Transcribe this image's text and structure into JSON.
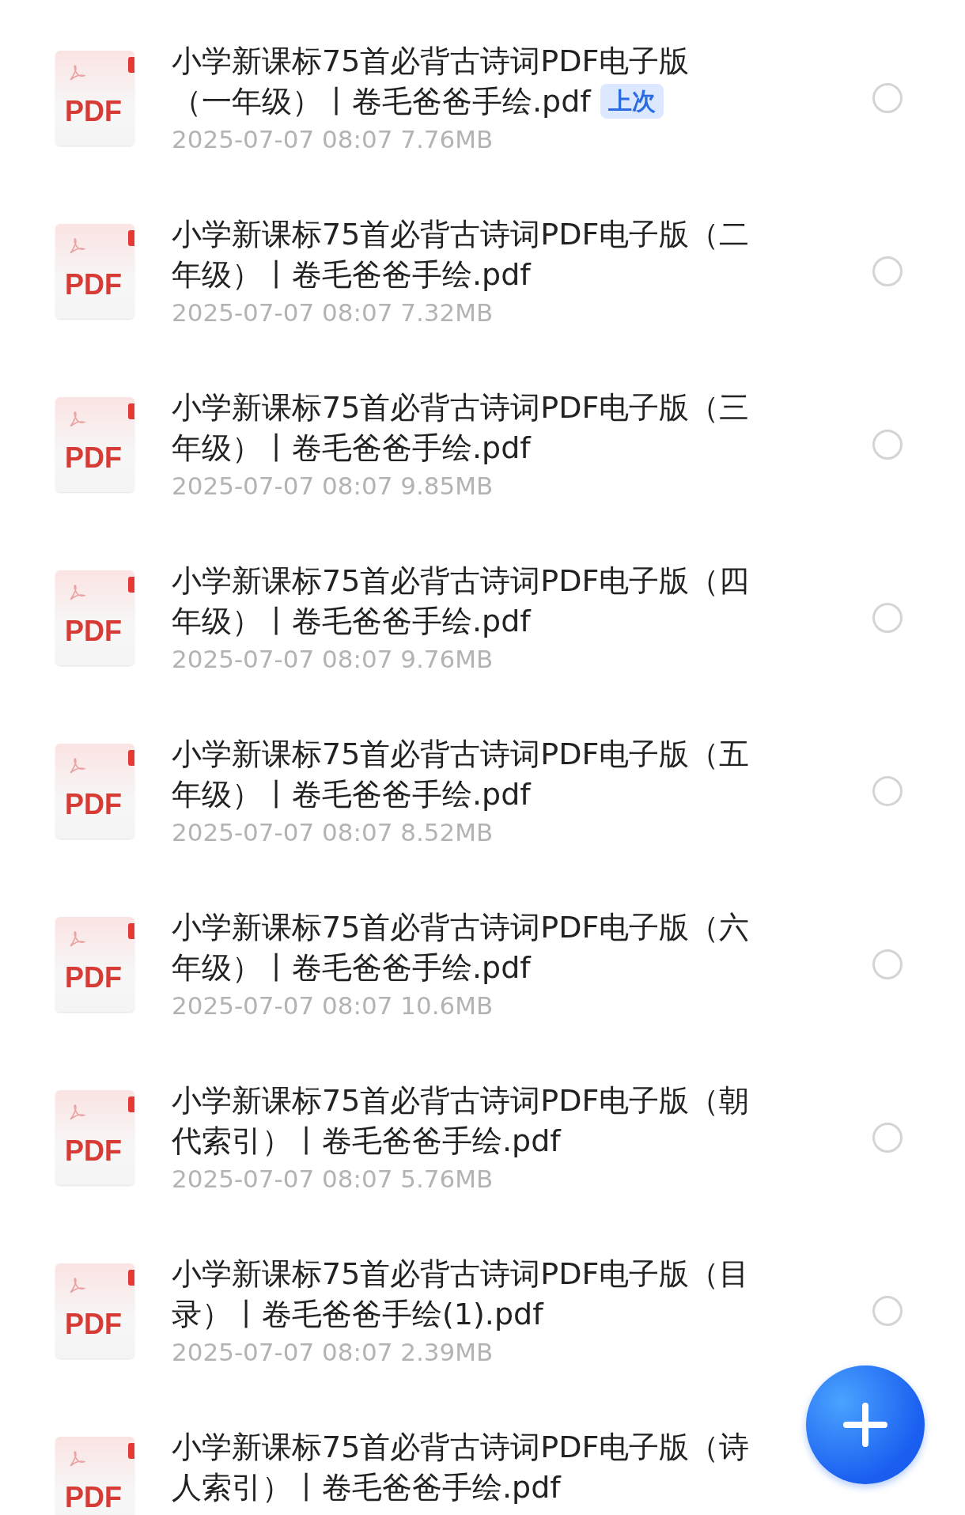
{
  "files": [
    {
      "icon_label": "PDF",
      "title": [
        "小学新课标75首必背古诗词PDF电子版",
        "（一年级）丨卷毛爸爸手绘.pdf"
      ],
      "badge": "上次",
      "meta": "2025-07-07 08:07  7.76MB",
      "selected": false
    },
    {
      "icon_label": "PDF",
      "title": [
        "小学新课标75首必背古诗词PDF电子版（二",
        "年级）丨卷毛爸爸手绘.pdf"
      ],
      "meta": "2025-07-07 08:07  7.32MB",
      "selected": false
    },
    {
      "icon_label": "PDF",
      "title": [
        "小学新课标75首必背古诗词PDF电子版（三",
        "年级）丨卷毛爸爸手绘.pdf"
      ],
      "meta": "2025-07-07 08:07  9.85MB",
      "selected": false
    },
    {
      "icon_label": "PDF",
      "title": [
        "小学新课标75首必背古诗词PDF电子版（四",
        "年级）丨卷毛爸爸手绘.pdf"
      ],
      "meta": "2025-07-07 08:07  9.76MB",
      "selected": false
    },
    {
      "icon_label": "PDF",
      "title": [
        "小学新课标75首必背古诗词PDF电子版（五",
        "年级）丨卷毛爸爸手绘.pdf"
      ],
      "meta": "2025-07-07 08:07  8.52MB",
      "selected": false
    },
    {
      "icon_label": "PDF",
      "title": [
        "小学新课标75首必背古诗词PDF电子版（六",
        "年级）丨卷毛爸爸手绘.pdf"
      ],
      "meta": "2025-07-07 08:07  10.6MB",
      "selected": false
    },
    {
      "icon_label": "PDF",
      "title": [
        "小学新课标75首必背古诗词PDF电子版（朝",
        "代索引）丨卷毛爸爸手绘.pdf"
      ],
      "meta": "2025-07-07 08:07  5.76MB",
      "selected": false
    },
    {
      "icon_label": "PDF",
      "title": [
        "小学新课标75首必背古诗词PDF电子版（目",
        "录）丨卷毛爸爸手绘(1).pdf"
      ],
      "meta": "2025-07-07 08:07  2.39MB",
      "selected": false
    },
    {
      "icon_label": "PDF",
      "title": [
        "小学新课标75首必背古诗词PDF电子版（诗",
        "人索引）丨卷毛爸爸手绘.pdf"
      ]
    }
  ]
}
